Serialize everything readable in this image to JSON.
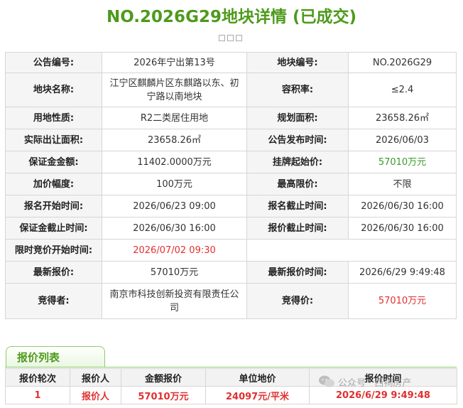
{
  "title": "NO.2026G29地块详情 (已成交)",
  "details": {
    "notice_no_label": "公告编号:",
    "notice_no": "2026年宁出第13号",
    "parcel_no_label": "地块编号:",
    "parcel_no": "NO.2026G29",
    "parcel_name_label": "地块名称:",
    "parcel_name": "江宁区麒麟片区东麒路以东、初宁路以南地块",
    "far_label": "容积率:",
    "far": "≤2.4",
    "land_use_label": "用地性质:",
    "land_use": "R2二类居住用地",
    "planned_area_label": "规划面积:",
    "planned_area": "23658.26㎡",
    "actual_area_label": "实际出让面积:",
    "actual_area": "23658.26㎡",
    "publish_time_label": "公告发布时间:",
    "publish_time": "2026/06/03",
    "deposit_label": "保证金金额:",
    "deposit": "11402.0000万元",
    "start_price_label": "挂牌起始价:",
    "start_price": "57010万元",
    "increment_label": "加价幅度:",
    "increment": "100万元",
    "max_price_label": "最高限价:",
    "max_price": "不限",
    "reg_start_label": "报名开始时间:",
    "reg_start": "2026/06/23 09:00",
    "reg_end_label": "报名截止时间:",
    "reg_end": "2026/06/30 16:00",
    "deposit_deadline_label": "保证金截止时间:",
    "deposit_deadline": "2026/06/30 16:00",
    "bid_deadline_label": "报价截止时间:",
    "bid_deadline": "2026/06/30 16:00",
    "auction_start_label": "限时竞价开始时间:",
    "auction_start": "2026/07/02 09:30",
    "latest_price_label": "最新报价:",
    "latest_price": "57010万元",
    "latest_time_label": "最新报价时间:",
    "latest_time": "2026/6/29 9:49:48",
    "winner_label": "竞得者:",
    "winner": "南京市科技创新投资有限责任公司",
    "win_price_label": "竞得价:",
    "win_price": "57010万元"
  },
  "bid_list": {
    "tab_label": "报价列表",
    "headers": [
      "报价轮次",
      "报价人",
      "金额报价",
      "单位地价",
      "报价时间"
    ],
    "rows": [
      [
        "1",
        "报价人",
        "57010万元",
        "24097元/平米",
        "2026/6/29 9:49:48"
      ]
    ]
  },
  "watermark": {
    "text": "公众号 · 西祠房产",
    "icon": "wechat-icon"
  }
}
